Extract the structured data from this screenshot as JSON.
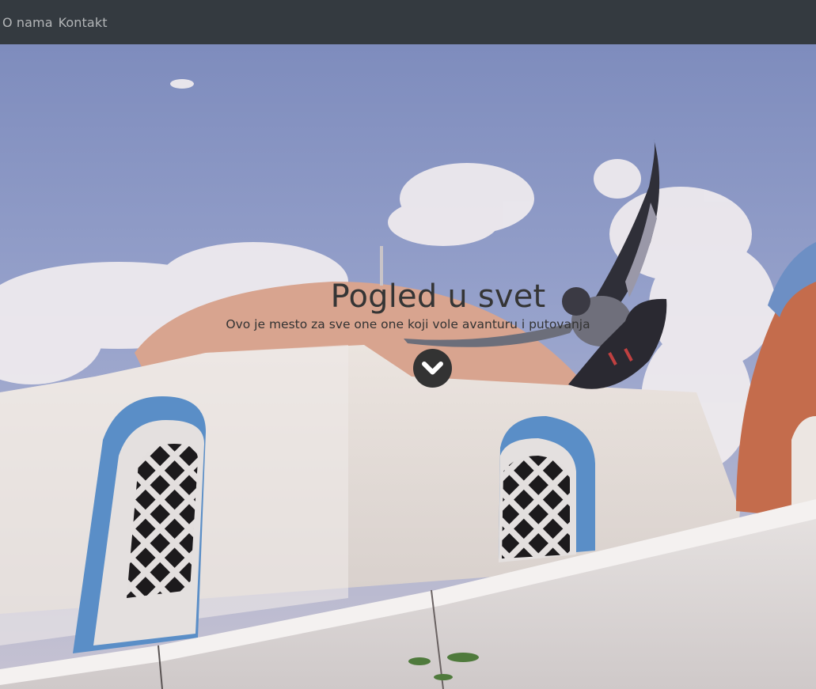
{
  "nav": {
    "items": [
      {
        "label": "O nama"
      },
      {
        "label": "Kontakt"
      }
    ]
  },
  "hero": {
    "title": "Pogled u svet",
    "subtitle": "Ovo je mesto za sve one one koji vole avanturu i putovanja",
    "scroll_icon": "chevron-down-icon"
  },
  "colors": {
    "navbar_bg": "#343a40",
    "nav_text": "#a8aaac",
    "hero_text": "#333333",
    "sky": "#8a97c4",
    "window_frame": "#5a8ec7"
  }
}
